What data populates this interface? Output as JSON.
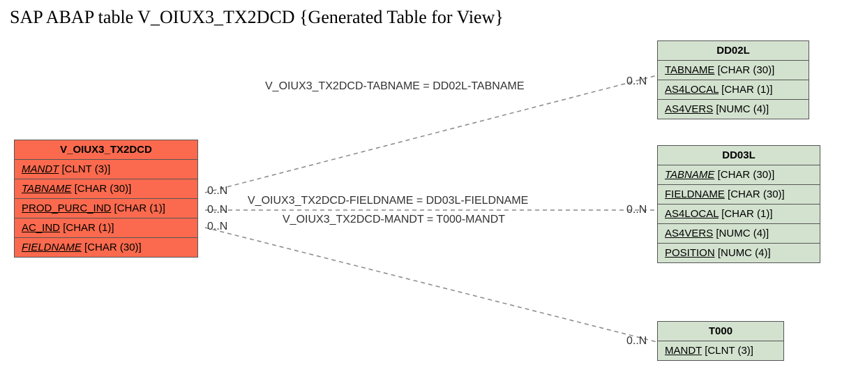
{
  "title": "SAP ABAP table V_OIUX3_TX2DCD {Generated Table for View}",
  "mainBox": {
    "header": "V_OIUX3_TX2DCD",
    "fields": [
      {
        "name": "MANDT",
        "type": "[CLNT (3)]",
        "italic": true
      },
      {
        "name": "TABNAME",
        "type": "[CHAR (30)]",
        "italic": true
      },
      {
        "name": "PROD_PURC_IND",
        "type": "[CHAR (1)]",
        "italic": false
      },
      {
        "name": "AC_IND",
        "type": "[CHAR (1)]",
        "italic": false
      },
      {
        "name": "FIELDNAME",
        "type": "[CHAR (30)]",
        "italic": true
      }
    ]
  },
  "dd02l": {
    "header": "DD02L",
    "fields": [
      {
        "name": "TABNAME",
        "type": "[CHAR (30)]",
        "italic": false
      },
      {
        "name": "AS4LOCAL",
        "type": "[CHAR (1)]",
        "italic": false
      },
      {
        "name": "AS4VERS",
        "type": "[NUMC (4)]",
        "italic": false
      }
    ]
  },
  "dd03l": {
    "header": "DD03L",
    "fields": [
      {
        "name": "TABNAME",
        "type": "[CHAR (30)]",
        "italic": true
      },
      {
        "name": "FIELDNAME",
        "type": "[CHAR (30)]",
        "italic": false
      },
      {
        "name": "AS4LOCAL",
        "type": "[CHAR (1)]",
        "italic": false
      },
      {
        "name": "AS4VERS",
        "type": "[NUMC (4)]",
        "italic": false
      },
      {
        "name": "POSITION",
        "type": "[NUMC (4)]",
        "italic": false
      }
    ]
  },
  "t000": {
    "header": "T000",
    "fields": [
      {
        "name": "MANDT",
        "type": "[CLNT (3)]",
        "italic": false
      }
    ]
  },
  "relations": {
    "r1": "V_OIUX3_TX2DCD-TABNAME = DD02L-TABNAME",
    "r2": "V_OIUX3_TX2DCD-FIELDNAME = DD03L-FIELDNAME",
    "r3": "V_OIUX3_TX2DCD-MANDT = T000-MANDT"
  },
  "card": {
    "leftTop": "0..N",
    "leftMid": "0..N",
    "leftBot": "0..N",
    "rightTop": "0..N",
    "rightMid": "0..N",
    "rightBot": "0..N"
  }
}
